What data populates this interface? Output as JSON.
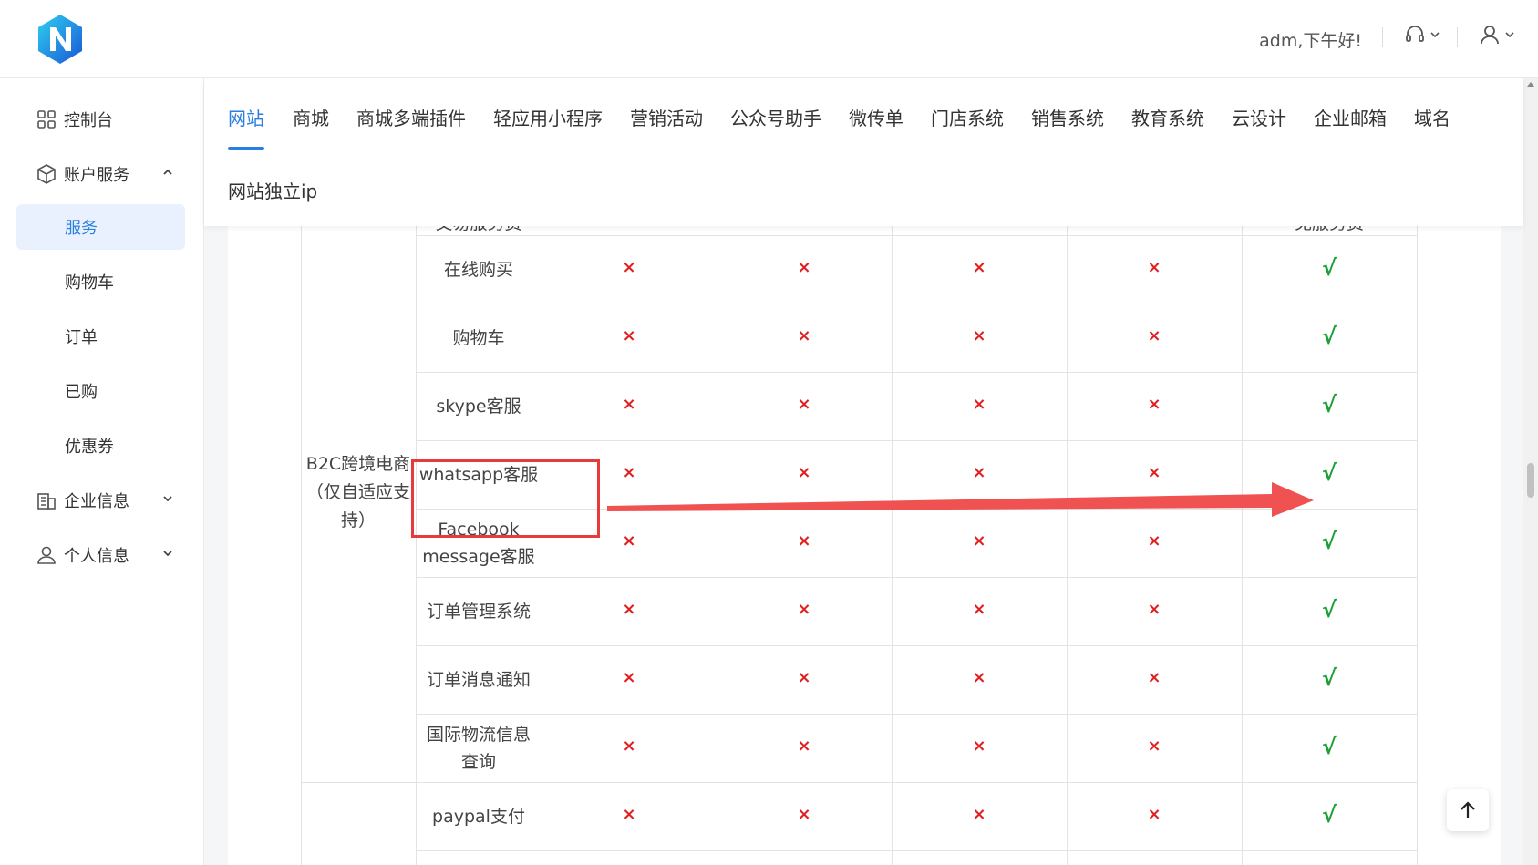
{
  "header": {
    "greeting": "adm,下午好!",
    "support_icon": "headset-icon",
    "user_icon": "user-icon"
  },
  "sidebar": {
    "items": [
      {
        "label": "控制台",
        "icon": "dashboard-grid-icon"
      },
      {
        "label": "账户服务",
        "icon": "box-icon",
        "expanded": true
      },
      {
        "label": "服务",
        "active": true
      },
      {
        "label": "购物车"
      },
      {
        "label": "订单"
      },
      {
        "label": "已购"
      },
      {
        "label": "优惠券"
      },
      {
        "label": "企业信息",
        "icon": "building-icon"
      },
      {
        "label": "个人信息",
        "icon": "person-icon"
      }
    ]
  },
  "tabs": {
    "items": [
      "网站",
      "商城",
      "商城多端插件",
      "轻应用小程序",
      "营销活动",
      "公众号助手",
      "微传单",
      "门店系统",
      "销售系统",
      "教育系统",
      "云设计",
      "企业邮箱",
      "域名",
      "网站独立ip"
    ],
    "active": "网站"
  },
  "table": {
    "partial_top_row": {
      "label": "交易服务费",
      "values": [
        "-",
        "-",
        "-",
        "-",
        "免服务费"
      ]
    },
    "group_label": "B2C跨境电商（仅自适应支持）",
    "group_label_lines": [
      "B2C跨境电商",
      "（仅自适应支",
      "持）"
    ],
    "rows": [
      {
        "label": "在线购买",
        "marks": [
          "×",
          "×",
          "×",
          "×",
          "√"
        ]
      },
      {
        "label": "购物车",
        "marks": [
          "×",
          "×",
          "×",
          "×",
          "√"
        ]
      },
      {
        "label": "skype客服",
        "marks": [
          "×",
          "×",
          "×",
          "×",
          "√"
        ]
      },
      {
        "label": "whatsapp客服",
        "marks": [
          "×",
          "×",
          "×",
          "×",
          "√"
        ],
        "highlighted": true
      },
      {
        "label_lines": [
          "Facebook",
          "message客服"
        ],
        "marks": [
          "×",
          "×",
          "×",
          "×",
          "√"
        ]
      },
      {
        "label": "订单管理系统",
        "marks": [
          "×",
          "×",
          "×",
          "×",
          "√"
        ]
      },
      {
        "label": "订单消息通知",
        "marks": [
          "×",
          "×",
          "×",
          "×",
          "√"
        ]
      },
      {
        "label_lines": [
          "国际物流信息",
          "查询"
        ],
        "marks": [
          "×",
          "×",
          "×",
          "×",
          "√"
        ]
      },
      {
        "label": "paypal支付",
        "marks": [
          "×",
          "×",
          "×",
          "×",
          "√"
        ]
      }
    ]
  },
  "colors": {
    "accent": "#2b7fe2",
    "cross": "#e02020",
    "check": "#1aa035",
    "annotation": "#e83a3a"
  },
  "back_to_top_icon": "arrow-up-icon"
}
